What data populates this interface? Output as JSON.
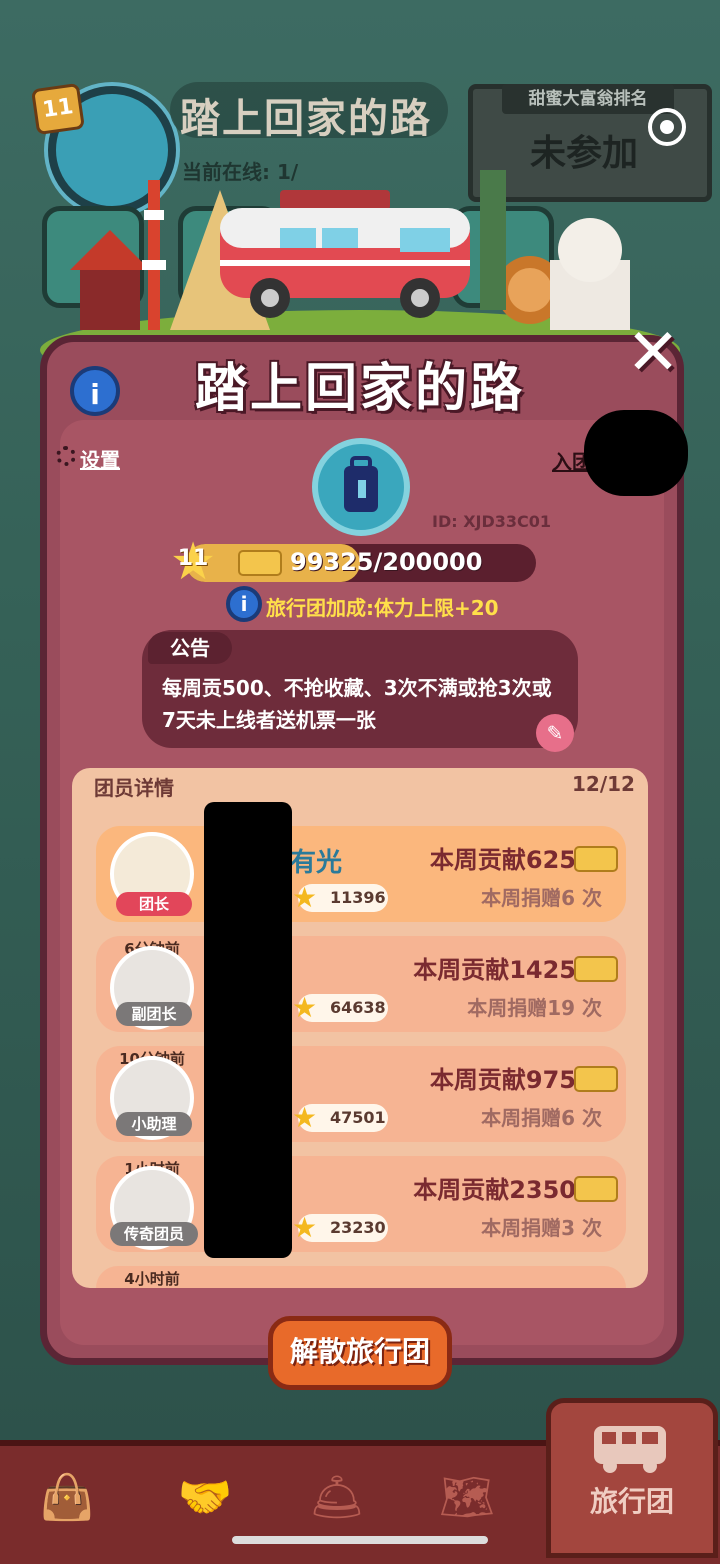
{
  "background": {
    "team_title": "踏上回家的路",
    "online_label": "当前在线: 1/",
    "level": "11",
    "ranking": {
      "tag": "甜蜜大富翁排名",
      "value": "未参加"
    }
  },
  "panel": {
    "title": "踏上回家的路",
    "settings_label": "设置",
    "apply_label": "入团申",
    "team_id": "ID: XJD33C01",
    "level": "11",
    "xp": {
      "current": 99325,
      "max": 200000,
      "text": "99325/200000"
    },
    "bonus": "旅行团加成:体力上限+20",
    "notice": {
      "tag": "公告",
      "text": "每周贡500、不抢收藏、3次不满或抢3次或7天未上线者送机票一张"
    },
    "members_header": "团员详情",
    "members_count": "12/12",
    "members": [
      {
        "ago": "",
        "role": "团长",
        "name": "有光",
        "score": "11396",
        "contribution": "本周贡献625",
        "donations": "本周捐赠6 次"
      },
      {
        "ago": "6分钟前",
        "role": "副团长",
        "name": "",
        "score": "64638",
        "contribution": "本周贡献1425",
        "donations": "本周捐赠19 次"
      },
      {
        "ago": "10分钟前",
        "role": "小助理",
        "name": "",
        "score": "47501",
        "contribution": "本周贡献975",
        "donations": "本周捐赠6 次"
      },
      {
        "ago": "1小时前",
        "role": "传奇团员",
        "name": "",
        "score": "23230",
        "contribution": "本周贡献2350",
        "donations": "本周捐赠3 次"
      }
    ],
    "next_ago": "4小时前",
    "dissolve_label": "解散旅行团"
  },
  "nav": {
    "tabs": [
      {
        "icon": "bag-icon"
      },
      {
        "icon": "handshake-icon"
      },
      {
        "icon": "service-bell-icon"
      },
      {
        "icon": "map-icon"
      }
    ],
    "active_label": "旅行团"
  },
  "colors": {
    "panel": "#9a4c5c",
    "panel_border": "#5b2535",
    "accent": "#e86a2a",
    "bonus": "#ffe04a"
  }
}
